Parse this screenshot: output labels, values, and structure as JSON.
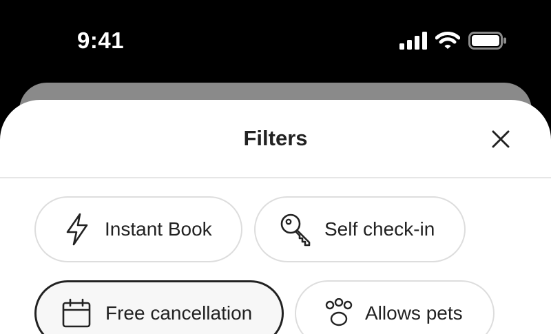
{
  "status_bar": {
    "time": "9:41",
    "icons": [
      "cellular-signal-icon",
      "wifi-icon",
      "battery-icon"
    ]
  },
  "sheet": {
    "title": "Filters",
    "close_icon": "close-icon"
  },
  "chips": [
    {
      "label": "Instant Book",
      "icon": "lightning-bolt-icon",
      "selected": false
    },
    {
      "label": "Self check-in",
      "icon": "key-icon",
      "selected": false
    },
    {
      "label": "Free cancellation",
      "icon": "calendar-icon",
      "selected": true
    },
    {
      "label": "Allows pets",
      "icon": "paw-icon",
      "selected": false
    }
  ],
  "colors": {
    "background": "#000000",
    "sheet": "#ffffff",
    "text": "#222222",
    "chip_border": "#dddddd",
    "selected_border": "#222222"
  }
}
